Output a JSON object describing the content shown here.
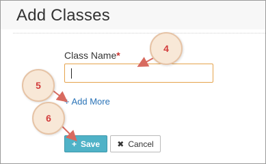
{
  "page": {
    "title": "Add Classes"
  },
  "form": {
    "class_name_label": "Class Name",
    "required_marker": "*",
    "class_name_value": "",
    "add_more_link": "+ Add More"
  },
  "buttons": {
    "save_icon": "+",
    "save_label": "Save",
    "cancel_icon": "✖",
    "cancel_label": "Cancel"
  },
  "callouts": [
    "4",
    "5",
    "6"
  ],
  "colors": {
    "accent": "#4fb2c7",
    "input_focus_border": "#e5a24a",
    "link": "#2a73b7",
    "callout_text": "#d23b3b",
    "required": "#c9302c"
  }
}
